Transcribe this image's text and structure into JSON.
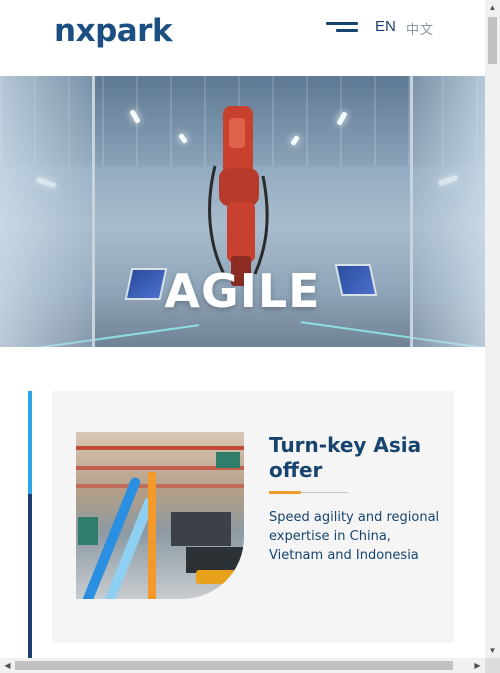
{
  "header": {
    "logo_text": "nxpark",
    "menu_icon": "hamburger-menu-icon",
    "lang_current": "EN",
    "lang_other": "中文"
  },
  "hero": {
    "title": "AGILE"
  },
  "card": {
    "title": "Turn-key Asia offer",
    "description": "Speed agility and regional expertise in China, Vietnam and Indonesia",
    "accent_color": "#f29a2e"
  },
  "colors": {
    "brand": "#1b4f82",
    "accent_light_blue": "#2aa6e8",
    "accent_dark_blue": "#1b3f6e",
    "card_bg": "#f5f5f5"
  },
  "scrollbars": {
    "up_icon": "arrow-up-icon",
    "down_icon": "arrow-down-icon",
    "left_icon": "arrow-left-icon",
    "right_icon": "arrow-right-icon"
  }
}
